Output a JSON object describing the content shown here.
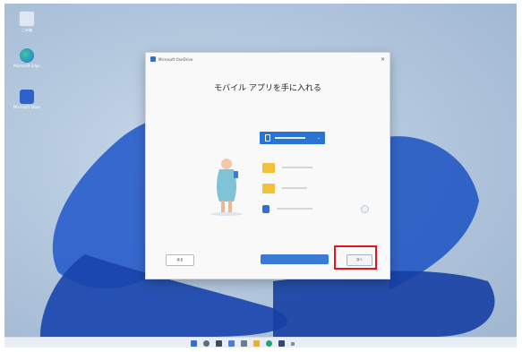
{
  "desktop": {
    "icons": [
      {
        "name": "recycle-bin-icon",
        "label": "ごみ箱"
      },
      {
        "name": "edge-icon",
        "label": "Microsoft Edge"
      },
      {
        "name": "windows-store-icon",
        "label": "Microsoft Store"
      }
    ]
  },
  "dialog": {
    "window_title": "Microsoft OneDrive",
    "heading": "モバイル アプリを手に入れる",
    "description": "",
    "buttons": {
      "back": "戻る",
      "link": "",
      "next": "次へ"
    }
  },
  "colors": {
    "accent": "#2b73d2",
    "highlight": "#e8141c",
    "folder": "#f1c13a"
  },
  "taskbar": {
    "clock_time": "",
    "clock_date": ""
  }
}
